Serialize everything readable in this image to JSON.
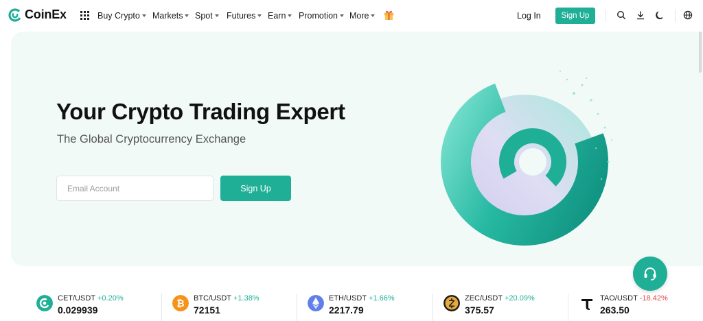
{
  "header": {
    "logo_text": "CoinEx",
    "nav": [
      {
        "label": "Buy Crypto"
      },
      {
        "label": "Markets"
      },
      {
        "label": "Spot"
      },
      {
        "label": "Futures"
      },
      {
        "label": "Earn"
      },
      {
        "label": "Promotion"
      },
      {
        "label": "More"
      }
    ],
    "login_label": "Log In",
    "signup_label": "Sign Up",
    "icons": [
      "search-icon",
      "download-icon",
      "moon-icon",
      "globe-icon"
    ]
  },
  "hero": {
    "title": "Your Crypto Trading Expert",
    "subtitle": "The Global Cryptocurrency Exchange",
    "email_placeholder": "Email Account",
    "email_value": "",
    "signup_label": "Sign Up"
  },
  "tickers": [
    {
      "pair": "CET/USDT",
      "change": "+0.20%",
      "price": "0.029939",
      "direction": "up",
      "icon": "cet-icon",
      "color": "#1fae96"
    },
    {
      "pair": "BTC/USDT",
      "change": "+1.38%",
      "price": "72151",
      "direction": "up",
      "icon": "btc-icon",
      "color": "#f7931a"
    },
    {
      "pair": "ETH/USDT",
      "change": "+1.66%",
      "price": "2217.79",
      "direction": "up",
      "icon": "eth-icon",
      "color": "#627eea"
    },
    {
      "pair": "ZEC/USDT",
      "change": "+20.09%",
      "price": "375.57",
      "direction": "up",
      "icon": "zec-icon",
      "color": "#e5a93d"
    },
    {
      "pair": "TAO/USDT",
      "change": "-18.42%",
      "price": "263.50",
      "direction": "down",
      "icon": "tao-icon",
      "color": "#111111"
    }
  ],
  "colors": {
    "brand": "#1fae96",
    "hero_bg": "#f1faf7",
    "negative": "#e04848"
  }
}
